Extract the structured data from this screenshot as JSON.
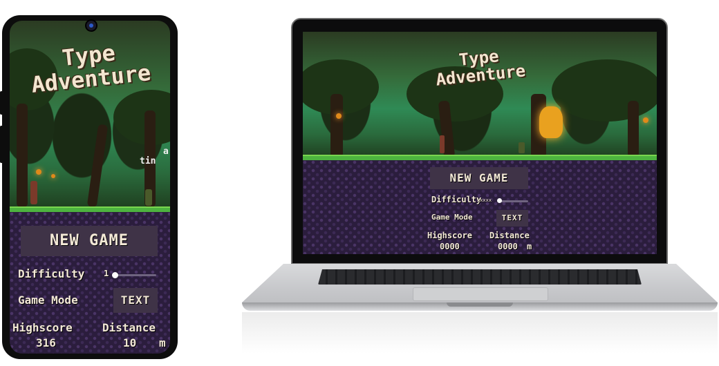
{
  "game": {
    "title_line1": "Type",
    "title_line2": "Adventure",
    "new_game_label": "NEW GAME",
    "difficulty_label": "Difficulty",
    "game_mode_label": "Game Mode",
    "game_mode_value": "TEXT",
    "highscore_label": "Highscore",
    "distance_label": "Distance",
    "distance_unit": "m"
  },
  "phone": {
    "difficulty_value": "1",
    "highscore_value": "316",
    "distance_value": "10",
    "typing_word": "tin",
    "typing_next": "a"
  },
  "laptop": {
    "difficulty_value": "xxxxx",
    "highscore_value": "0000",
    "distance_value": "0000"
  },
  "colors": {
    "menu_bg": "#2b1d3d",
    "button_bg": "#3f3347",
    "text": "#f3e9d6",
    "grass": "#4db33f"
  }
}
